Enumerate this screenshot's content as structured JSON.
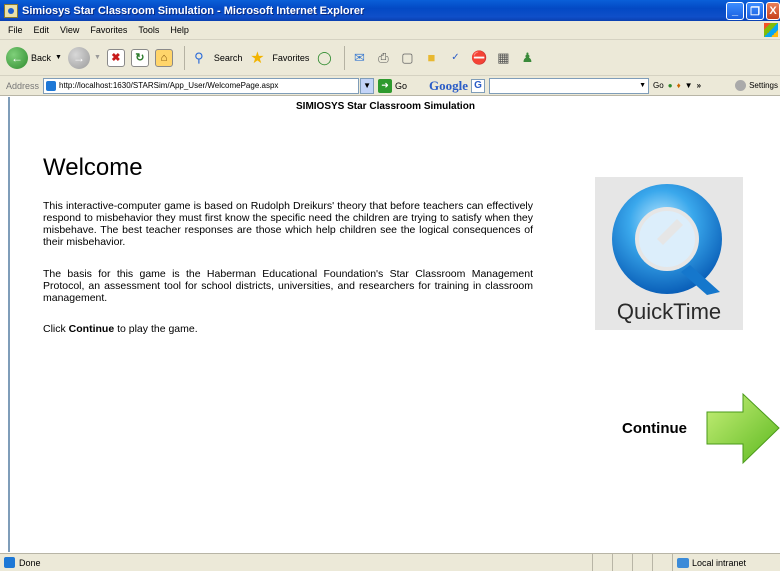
{
  "window": {
    "title": "Simiosys Star Classroom Simulation - Microsoft Internet Explorer",
    "minimize_icon": "_",
    "maximize_icon": "❐",
    "close_icon": "X"
  },
  "menu": {
    "items": [
      "File",
      "Edit",
      "View",
      "Favorites",
      "Tools",
      "Help"
    ]
  },
  "toolbar": {
    "back_label": "Back",
    "search_label": "Search",
    "favorites_label": "Favorites"
  },
  "address": {
    "label": "Address",
    "url": "http://localhost:1630/STARSim/App_User/WelcomePage.aspx",
    "go_label": "Go"
  },
  "google_bar": {
    "logo": "Google",
    "go_label": "Go",
    "settings_label": "Settings"
  },
  "page": {
    "header": "SIMIOSYS Star Classroom Simulation",
    "heading": "Welcome",
    "paragraph1": "This interactive-computer game is based on Rudolph Dreikurs' theory that before teachers can effectively respond to misbehavior they must first know the specific need the children are trying to satisfy when they misbehave. The best teacher responses are those which help children see the logical consequences of their misbehavior.",
    "paragraph2": "The basis for this game is the Haberman Educational Foundation's Star Classroom Management Protocol, an assessment tool for school districts, universities, and researchers for training in classroom management.",
    "paragraph3_prefix": "Click ",
    "paragraph3_bold": "Continue",
    "paragraph3_suffix": " to play the game.",
    "quicktime_label": "QuickTime",
    "continue_label": "Continue"
  },
  "status": {
    "text": "Done",
    "zone": "Local intranet"
  }
}
